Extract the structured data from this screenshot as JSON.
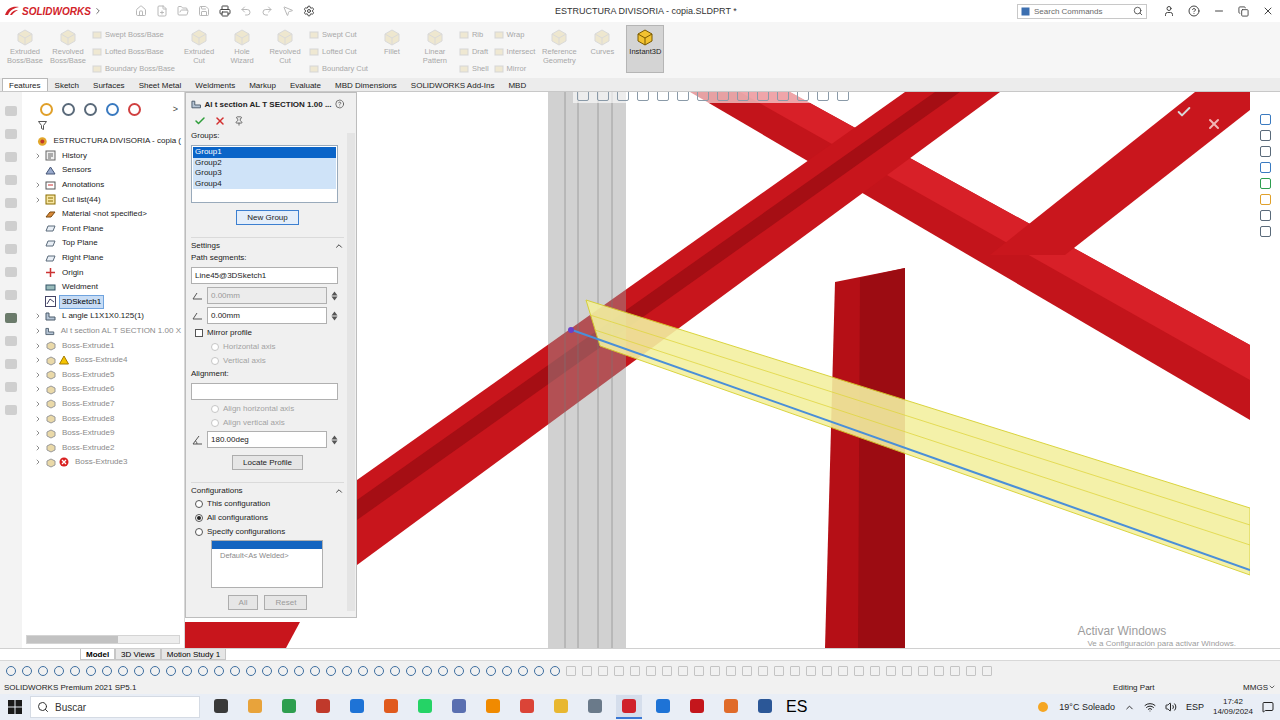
{
  "window": {
    "logo": "SOLIDWORKS",
    "title": "ESTRUCTURA DIVISORIA - copia.SLDPRT *",
    "search_placeholder": "Search Commands"
  },
  "ribbon": [
    {
      "kind": "large",
      "items": [
        {
          "label": "Extruded Boss/Base",
          "disabled": true,
          "selected": false
        }
      ]
    },
    {
      "kind": "large",
      "items": [
        {
          "label": "Revolved Boss/Base",
          "disabled": true,
          "selected": false
        }
      ]
    },
    {
      "kind": "stack",
      "items": [
        {
          "label": "Swept Boss/Base",
          "disabled": true,
          "selected": false
        },
        {
          "label": "Lofted Boss/Base",
          "disabled": true,
          "selected": false
        },
        {
          "label": "Boundary Boss/Base",
          "disabled": true,
          "selected": false
        }
      ]
    },
    {
      "kind": "large",
      "items": [
        {
          "label": "Extruded Cut",
          "disabled": true,
          "selected": false
        }
      ]
    },
    {
      "kind": "large",
      "items": [
        {
          "label": "Hole Wizard",
          "disabled": true,
          "selected": false
        }
      ]
    },
    {
      "kind": "large",
      "items": [
        {
          "label": "Revolved Cut",
          "disabled": true,
          "selected": false
        }
      ]
    },
    {
      "kind": "stack",
      "items": [
        {
          "label": "Swept Cut",
          "disabled": true,
          "selected": false
        },
        {
          "label": "Lofted Cut",
          "disabled": true,
          "selected": false
        },
        {
          "label": "Boundary Cut",
          "disabled": true,
          "selected": false
        }
      ]
    },
    {
      "kind": "large",
      "items": [
        {
          "label": "Fillet",
          "disabled": true,
          "selected": false
        }
      ]
    },
    {
      "kind": "large",
      "items": [
        {
          "label": "Linear Pattern",
          "disabled": true,
          "selected": false
        }
      ]
    },
    {
      "kind": "stack",
      "items": [
        {
          "label": "Rib",
          "disabled": true,
          "selected": false
        },
        {
          "label": "Draft",
          "disabled": true,
          "selected": false
        },
        {
          "label": "Shell",
          "disabled": true,
          "selected": false
        }
      ]
    },
    {
      "kind": "stack",
      "items": [
        {
          "label": "Wrap",
          "disabled": true,
          "selected": false
        },
        {
          "label": "Intersect",
          "disabled": true,
          "selected": false
        },
        {
          "label": "Mirror",
          "disabled": true,
          "selected": false
        }
      ]
    },
    {
      "kind": "large",
      "items": [
        {
          "label": "Reference Geometry",
          "disabled": true,
          "selected": false
        }
      ]
    },
    {
      "kind": "large",
      "items": [
        {
          "label": "Curves",
          "disabled": true,
          "selected": false
        }
      ]
    },
    {
      "kind": "large",
      "items": [
        {
          "label": "Instant3D",
          "disabled": false,
          "selected": true
        }
      ]
    }
  ],
  "tabs": [
    {
      "label": "Features",
      "selected": true
    },
    {
      "label": "Sketch",
      "selected": false
    },
    {
      "label": "Surfaces",
      "selected": false
    },
    {
      "label": "Sheet Metal",
      "selected": false
    },
    {
      "label": "Weldments",
      "selected": false
    },
    {
      "label": "Markup",
      "selected": false
    },
    {
      "label": "Evaluate",
      "selected": false
    },
    {
      "label": "MBD Dimensions",
      "selected": false
    },
    {
      "label": "SOLIDWORKS Add-Ins",
      "selected": false
    },
    {
      "label": "MBD",
      "selected": false
    }
  ],
  "tree": {
    "expand_arrow": ">",
    "items": [
      {
        "label": "ESTRUCTURA DIVISORIA - copia (",
        "kind": "part",
        "depth": 0,
        "expandable": false,
        "selected": false,
        "greyed": false,
        "status": "none"
      },
      {
        "label": "History",
        "kind": "history",
        "depth": 1,
        "expandable": true,
        "selected": false,
        "greyed": false,
        "status": "none"
      },
      {
        "label": "Sensors",
        "kind": "sensor",
        "depth": 1,
        "expandable": false,
        "selected": false,
        "greyed": false,
        "status": "none"
      },
      {
        "label": "Annotations",
        "kind": "annotation",
        "depth": 1,
        "expandable": true,
        "selected": false,
        "greyed": false,
        "status": "none"
      },
      {
        "label": "Cut list(44)",
        "kind": "cutlist",
        "depth": 1,
        "expandable": true,
        "selected": false,
        "greyed": false,
        "status": "none"
      },
      {
        "label": "Material <not specified>",
        "kind": "material",
        "depth": 1,
        "expandable": false,
        "selected": false,
        "greyed": false,
        "status": "none"
      },
      {
        "label": "Front Plane",
        "kind": "plane",
        "depth": 1,
        "expandable": false,
        "selected": false,
        "greyed": false,
        "status": "none"
      },
      {
        "label": "Top Plane",
        "kind": "plane",
        "depth": 1,
        "expandable": false,
        "selected": false,
        "greyed": false,
        "status": "none"
      },
      {
        "label": "Right Plane",
        "kind": "plane",
        "depth": 1,
        "expandable": false,
        "selected": false,
        "greyed": false,
        "status": "none"
      },
      {
        "label": "Origin",
        "kind": "origin",
        "depth": 1,
        "expandable": false,
        "selected": false,
        "greyed": false,
        "status": "none"
      },
      {
        "label": "Weldment",
        "kind": "weldment",
        "depth": 1,
        "expandable": false,
        "selected": false,
        "greyed": false,
        "status": "none"
      },
      {
        "label": "3DSketch1",
        "kind": "sketch",
        "depth": 1,
        "expandable": false,
        "selected": true,
        "greyed": false,
        "status": "none"
      },
      {
        "label": "L angle L1X1X0.125(1)",
        "kind": "member",
        "depth": 1,
        "expandable": true,
        "selected": false,
        "greyed": false,
        "status": "none"
      },
      {
        "label": "Al t section AL T SECTION 1.00 X",
        "kind": "member",
        "depth": 1,
        "expandable": true,
        "selected": false,
        "greyed": true,
        "status": "none"
      },
      {
        "label": "Boss-Extrude1",
        "kind": "feature",
        "depth": 1,
        "expandable": true,
        "selected": false,
        "greyed": true,
        "status": "none"
      },
      {
        "label": "Boss-Extrude4",
        "kind": "feature",
        "depth": 1,
        "expandable": true,
        "selected": false,
        "greyed": true,
        "status": "warning"
      },
      {
        "label": "Boss-Extrude5",
        "kind": "feature",
        "depth": 1,
        "expandable": true,
        "selected": false,
        "greyed": true,
        "status": "none"
      },
      {
        "label": "Boss-Extrude6",
        "kind": "feature",
        "depth": 1,
        "expandable": true,
        "selected": false,
        "greyed": true,
        "status": "none"
      },
      {
        "label": "Boss-Extrude7",
        "kind": "feature",
        "depth": 1,
        "expandable": true,
        "selected": false,
        "greyed": true,
        "status": "none"
      },
      {
        "label": "Boss-Extrude8",
        "kind": "feature",
        "depth": 1,
        "expandable": true,
        "selected": false,
        "greyed": true,
        "status": "none"
      },
      {
        "label": "Boss-Extrude9",
        "kind": "feature",
        "depth": 1,
        "expandable": true,
        "selected": false,
        "greyed": true,
        "status": "none"
      },
      {
        "label": "Boss-Extrude2",
        "kind": "feature",
        "depth": 1,
        "expandable": true,
        "selected": false,
        "greyed": true,
        "status": "none"
      },
      {
        "label": "Boss-Extrude3",
        "kind": "feature",
        "depth": 1,
        "expandable": true,
        "selected": false,
        "greyed": true,
        "status": "error"
      }
    ]
  },
  "property_manager": {
    "title": "Al t section AL T SECTION 1.00 ...",
    "groups_label": "Groups:",
    "groups": [
      {
        "label": "Group1",
        "selected": true
      },
      {
        "label": "Group2",
        "selected": false
      },
      {
        "label": "Group3",
        "selected": false
      },
      {
        "label": "Group4",
        "selected": false
      }
    ],
    "new_group": "New Group",
    "settings": {
      "header": "Settings",
      "path_label": "Path segments:",
      "path_value": "Line45@3DSketch1",
      "offsets": [
        {
          "value": "0.00mm",
          "disabled": true
        },
        {
          "value": "0.00mm",
          "disabled": false
        }
      ],
      "mirror": {
        "label": "Mirror profile",
        "checked": false
      },
      "mirror_axes": [
        {
          "label": "Horizontal axis",
          "selected": false,
          "disabled": true
        },
        {
          "label": "Vertical axis",
          "selected": false,
          "disabled": true
        }
      ],
      "alignment_label": "Alignment:",
      "alignment_value": "",
      "align_axes": [
        {
          "label": "Align horizontal axis",
          "selected": false,
          "disabled": true
        },
        {
          "label": "Align vertical axis",
          "selected": false,
          "disabled": true
        }
      ],
      "angle": "180.00deg",
      "locate": "Locate Profile"
    },
    "configurations": {
      "header": "Configurations",
      "options": [
        {
          "label": "This configuration",
          "selected": false
        },
        {
          "label": "All configurations",
          "selected": true
        },
        {
          "label": "Specify configurations",
          "selected": false
        }
      ],
      "list": [
        {
          "label": "Default<As Welded>",
          "disabled": true
        }
      ],
      "buttons": [
        {
          "label": "All",
          "disabled": true
        },
        {
          "label": "Reset",
          "disabled": true
        }
      ]
    }
  },
  "viewport": {
    "watermark_title": "Activar Windows",
    "watermark_text": "Ve a Configuración para activar Windows."
  },
  "bottom_tabs": [
    {
      "label": "Model",
      "selected": true
    },
    {
      "label": "3D Views",
      "selected": false
    },
    {
      "label": "Motion Study 1",
      "selected": false
    }
  ],
  "status_bar": {
    "product": "SOLIDWORKS Premium 2021 SP5.1",
    "mode": "Editing Part",
    "units": "MMGS"
  },
  "taskbar": {
    "search": "Buscar",
    "language_hint": "ES",
    "weather": "19°C Soleado",
    "keyboard": "ESP",
    "time": "17:42",
    "date": "14/09/2024",
    "apps": [
      {
        "color": "#3a3a3a",
        "selected": false
      },
      {
        "color": "#e8a33b",
        "selected": false
      },
      {
        "color": "#2e9e4f",
        "selected": false
      },
      {
        "color": "#c0392b",
        "selected": false
      },
      {
        "color": "#1e73d6",
        "selected": false
      },
      {
        "color": "#e05a1e",
        "selected": false
      },
      {
        "color": "#25d366",
        "selected": false
      },
      {
        "color": "#5a6fb0",
        "selected": false
      },
      {
        "color": "#f08a00",
        "selected": false
      },
      {
        "color": "#db4437",
        "selected": false
      },
      {
        "color": "#e8b730",
        "selected": false
      },
      {
        "color": "#6a7a8a",
        "selected": false
      },
      {
        "color": "#d0212a",
        "selected": true
      },
      {
        "color": "#1e73d6",
        "selected": false
      },
      {
        "color": "#c4161c",
        "selected": false
      },
      {
        "color": "#e06b2a",
        "selected": false
      },
      {
        "color": "#2b5797",
        "selected": false
      }
    ]
  }
}
